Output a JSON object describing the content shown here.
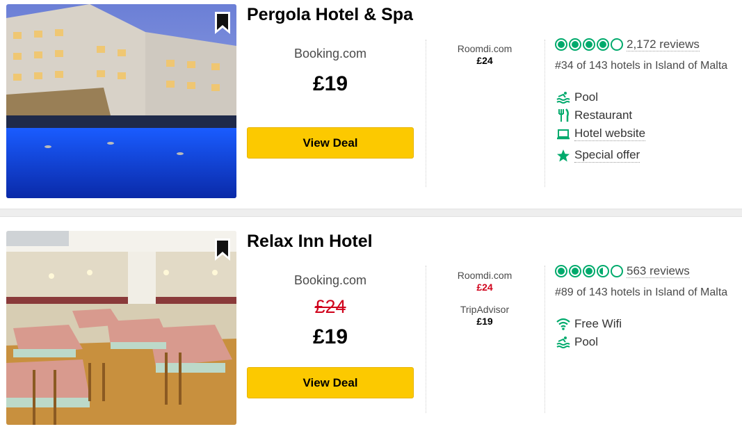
{
  "colors": {
    "accent_yellow": "#fcc900",
    "rating_green": "#00aa6c",
    "strike_red": "#d0021b"
  },
  "hotels": [
    {
      "name": "Pergola Hotel & Spa",
      "provider": "Booking.com",
      "price": "£19",
      "deal_label": "View Deal",
      "other_offers": [
        {
          "name": "Roomdi.com",
          "price": "£24"
        }
      ],
      "rating_bubbles": 4,
      "reviews": "2,172 reviews",
      "rank": "#34 of 143 hotels in Island of Malta",
      "amenities": [
        {
          "icon": "pool-icon",
          "label": "Pool"
        },
        {
          "icon": "restaurant-icon",
          "label": "Restaurant"
        },
        {
          "icon": "laptop-icon",
          "label": "Hotel website"
        },
        {
          "icon": "star-icon",
          "label": "Special offer"
        }
      ]
    },
    {
      "name": "Relax Inn Hotel",
      "provider": "Booking.com",
      "old_price": "£24",
      "price": "£19",
      "deal_label": "View Deal",
      "other_offers": [
        {
          "name": "Roomdi.com",
          "price": "£24"
        },
        {
          "name": "TripAdvisor",
          "price": "£19"
        }
      ],
      "rating_bubbles": 3.5,
      "reviews": "563 reviews",
      "rank": "#89 of 143 hotels in Island of Malta",
      "amenities": [
        {
          "icon": "wifi-icon",
          "label": "Free Wifi"
        },
        {
          "icon": "pool-icon",
          "label": "Pool"
        }
      ]
    }
  ]
}
